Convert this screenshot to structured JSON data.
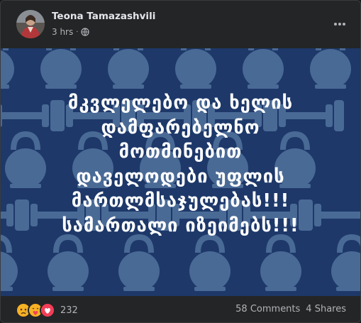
{
  "post": {
    "author": "Teona Tamazashvili",
    "time": "3 hrs",
    "separator": "·",
    "image_lines": [
      "მკვლელებო და ხელის",
      "დამფარებელნო",
      "მოთმინებით",
      "დაველოდები უფლის",
      "მართლმსაჯულებას!!!",
      "სამართალი იზეიმებს!!!"
    ],
    "image_bg_color": "#1d3869",
    "image_pattern": [
      "kettlebell-icon",
      "dumbbell-icon"
    ],
    "reactions": {
      "icons": [
        "sad-reaction-icon",
        "care-reaction-icon",
        "love-reaction-icon"
      ],
      "count": "232"
    },
    "comments": "58 Comments",
    "shares": "4 Shares"
  },
  "colors": {
    "card": "#242526",
    "text_primary": "#e4e6eb",
    "text_secondary": "#b0b3b8",
    "pattern": "#4a6a96"
  }
}
